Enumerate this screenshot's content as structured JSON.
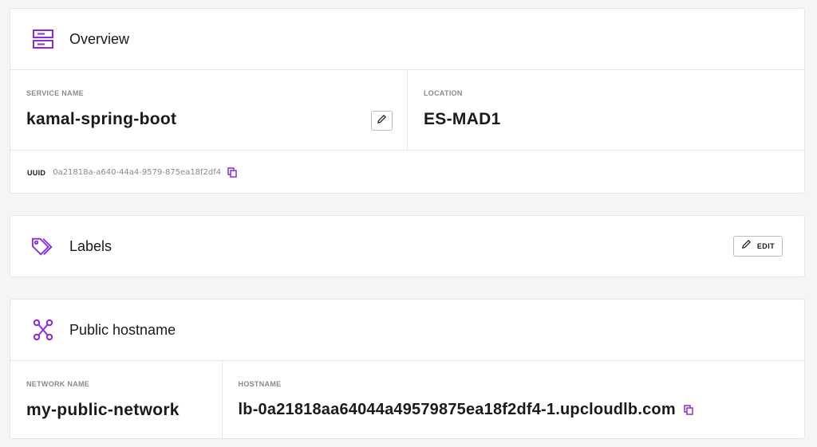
{
  "colors": {
    "accent": "#8a2be2",
    "border": "#e6e6e6",
    "muted": "#8a8a8a"
  },
  "overview": {
    "icon": "server-icon",
    "title": "Overview",
    "service_name_label": "SERVICE NAME",
    "service_name": "kamal-spring-boot",
    "location_label": "LOCATION",
    "location": "ES-MAD1",
    "uuid_label": "UUID",
    "uuid": "0a21818a-a640-44a4-9579-875ea18f2df4"
  },
  "labels": {
    "icon": "tag-icon",
    "title": "Labels",
    "edit_label": "EDIT"
  },
  "public_hostname": {
    "icon": "network-icon",
    "title": "Public hostname",
    "network_name_label": "NETWORK NAME",
    "network_name": "my-public-network",
    "hostname_label": "HOSTNAME",
    "hostname": "lb-0a21818aa64044a49579875ea18f2df4-1.upcloudlb.com"
  }
}
